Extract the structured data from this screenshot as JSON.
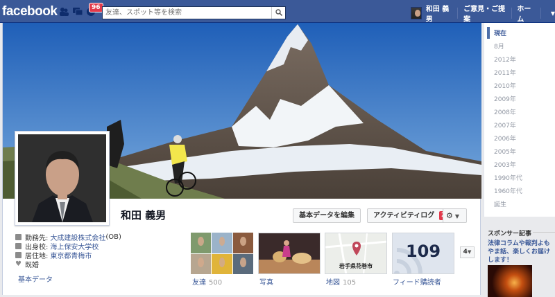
{
  "topbar": {
    "logo": "facebook",
    "notification_count": "96",
    "search_placeholder": "友達、スポット等を検索",
    "user_name": "和田 義男",
    "feedback": "ご意見・ご提案",
    "home": "ホーム"
  },
  "profile": {
    "name": "和田 義男",
    "edit_button": "基本データを編集",
    "activity_button": "アクティビティログ",
    "activity_count": "2"
  },
  "info": {
    "rows": [
      {
        "icon": "briefcase-icon",
        "key": "勤務先:",
        "value": "大成建設株式会社",
        "suffix": " (OB)"
      },
      {
        "icon": "school-icon",
        "key": "出身校:",
        "value": "海上保安大学校",
        "suffix": ""
      },
      {
        "icon": "house-icon",
        "key": "居住地:",
        "value": "東京都青梅市",
        "suffix": ""
      },
      {
        "icon": "heart-icon",
        "key": "既婚",
        "value": "",
        "suffix": ""
      }
    ],
    "link": "基本データ"
  },
  "tiles": {
    "friends_label": "友達",
    "friends_count": "500",
    "photos_label": "写真",
    "map_label": "地図",
    "map_count": "105",
    "map_place": "岩手県花巻市",
    "subs_label": "フィード購読者",
    "subs_count": "109",
    "more": "4"
  },
  "timeline": [
    "現在",
    "8月",
    "2012年",
    "2011年",
    "2010年",
    "2009年",
    "2008年",
    "2007年",
    "2006年",
    "2005年",
    "2003年",
    "1990年代",
    "1960年代",
    "誕生"
  ],
  "sponsor": {
    "title": "スポンサー記事",
    "ad_text": "法律コラムや裁判よもやま話、楽しくお届けします！"
  },
  "colors": {
    "brand": "#3b5998",
    "badge": "#e2394b"
  }
}
